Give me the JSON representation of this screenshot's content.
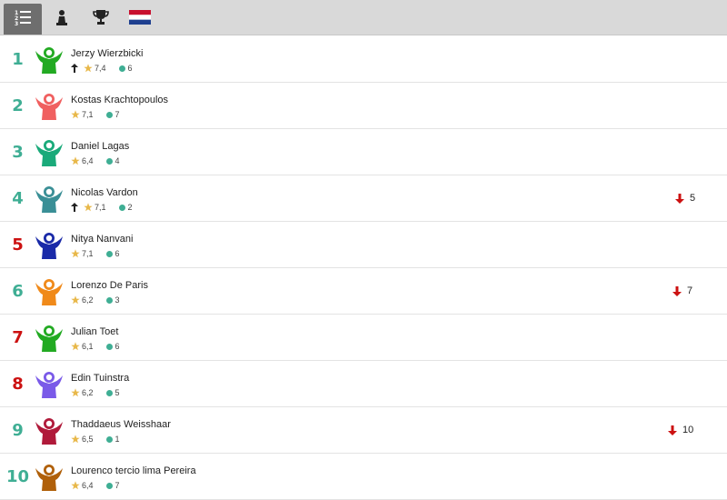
{
  "toolbar": {
    "tabs": [
      {
        "name": "ranking-list",
        "icon": "ranking-list-icon",
        "active": true
      },
      {
        "name": "player",
        "icon": "pawn-icon",
        "active": false
      },
      {
        "name": "trophy",
        "icon": "trophy-icon",
        "active": false
      },
      {
        "name": "country",
        "icon": "netherlands-flag-icon",
        "active": false
      }
    ]
  },
  "colors": {
    "rank_teal": "#3fae94",
    "rank_red": "#cc1111",
    "rating_dot": "#3fae94",
    "star": "#e8b84a",
    "arrow_down": "#cc1111"
  },
  "players": [
    {
      "rank": "1",
      "rank_color": "teal",
      "name": "Jerzy Wierzbicki",
      "trend_up": true,
      "rating": "7,4",
      "games": "6",
      "change": "",
      "avatar_color": "#22aa22",
      "avatar_icon": "player-avatar-icon"
    },
    {
      "rank": "2",
      "rank_color": "teal",
      "name": "Kostas Krachtopoulos",
      "trend_up": false,
      "rating": "7,1",
      "games": "7",
      "change": "",
      "avatar_color": "#f06060",
      "avatar_icon": "player-avatar-icon"
    },
    {
      "rank": "3",
      "rank_color": "teal",
      "name": "Daniel Lagas",
      "trend_up": false,
      "rating": "6,4",
      "games": "4",
      "change": "",
      "avatar_color": "#1aaa7a",
      "avatar_icon": "player-avatar-icon"
    },
    {
      "rank": "4",
      "rank_color": "teal",
      "name": "Nicolas Vardon",
      "trend_up": true,
      "rating": "7,1",
      "games": "2",
      "change": "5",
      "avatar_color": "#3a8f96",
      "avatar_icon": "player-avatar-icon"
    },
    {
      "rank": "5",
      "rank_color": "red",
      "name": "Nitya Nanvani",
      "trend_up": false,
      "rating": "7,1",
      "games": "6",
      "change": "",
      "avatar_color": "#1a2aa8",
      "avatar_icon": "player-avatar-icon"
    },
    {
      "rank": "6",
      "rank_color": "teal",
      "name": "Lorenzo De Paris",
      "trend_up": false,
      "rating": "6,2",
      "games": "3",
      "change": "7",
      "avatar_color": "#f08a1a",
      "avatar_icon": "player-avatar-icon"
    },
    {
      "rank": "7",
      "rank_color": "red",
      "name": "Julian Toet",
      "trend_up": false,
      "rating": "6,1",
      "games": "6",
      "change": "",
      "avatar_color": "#22aa22",
      "avatar_icon": "player-avatar-icon"
    },
    {
      "rank": "8",
      "rank_color": "red",
      "name": "Edin Tuinstra",
      "trend_up": false,
      "rating": "6,2",
      "games": "5",
      "change": "",
      "avatar_color": "#7a5ae8",
      "avatar_icon": "player-avatar-icon"
    },
    {
      "rank": "9",
      "rank_color": "teal",
      "name": "Thaddaeus Weisshaar",
      "trend_up": false,
      "rating": "6,5",
      "games": "1",
      "change": "10",
      "avatar_color": "#b01a3a",
      "avatar_icon": "player-avatar-icon"
    },
    {
      "rank": "10",
      "rank_color": "teal",
      "name": "Lourenco tercio lima Pereira",
      "trend_up": false,
      "rating": "6,4",
      "games": "7",
      "change": "",
      "avatar_color": "#b0600a",
      "avatar_icon": "player-avatar-icon"
    }
  ]
}
